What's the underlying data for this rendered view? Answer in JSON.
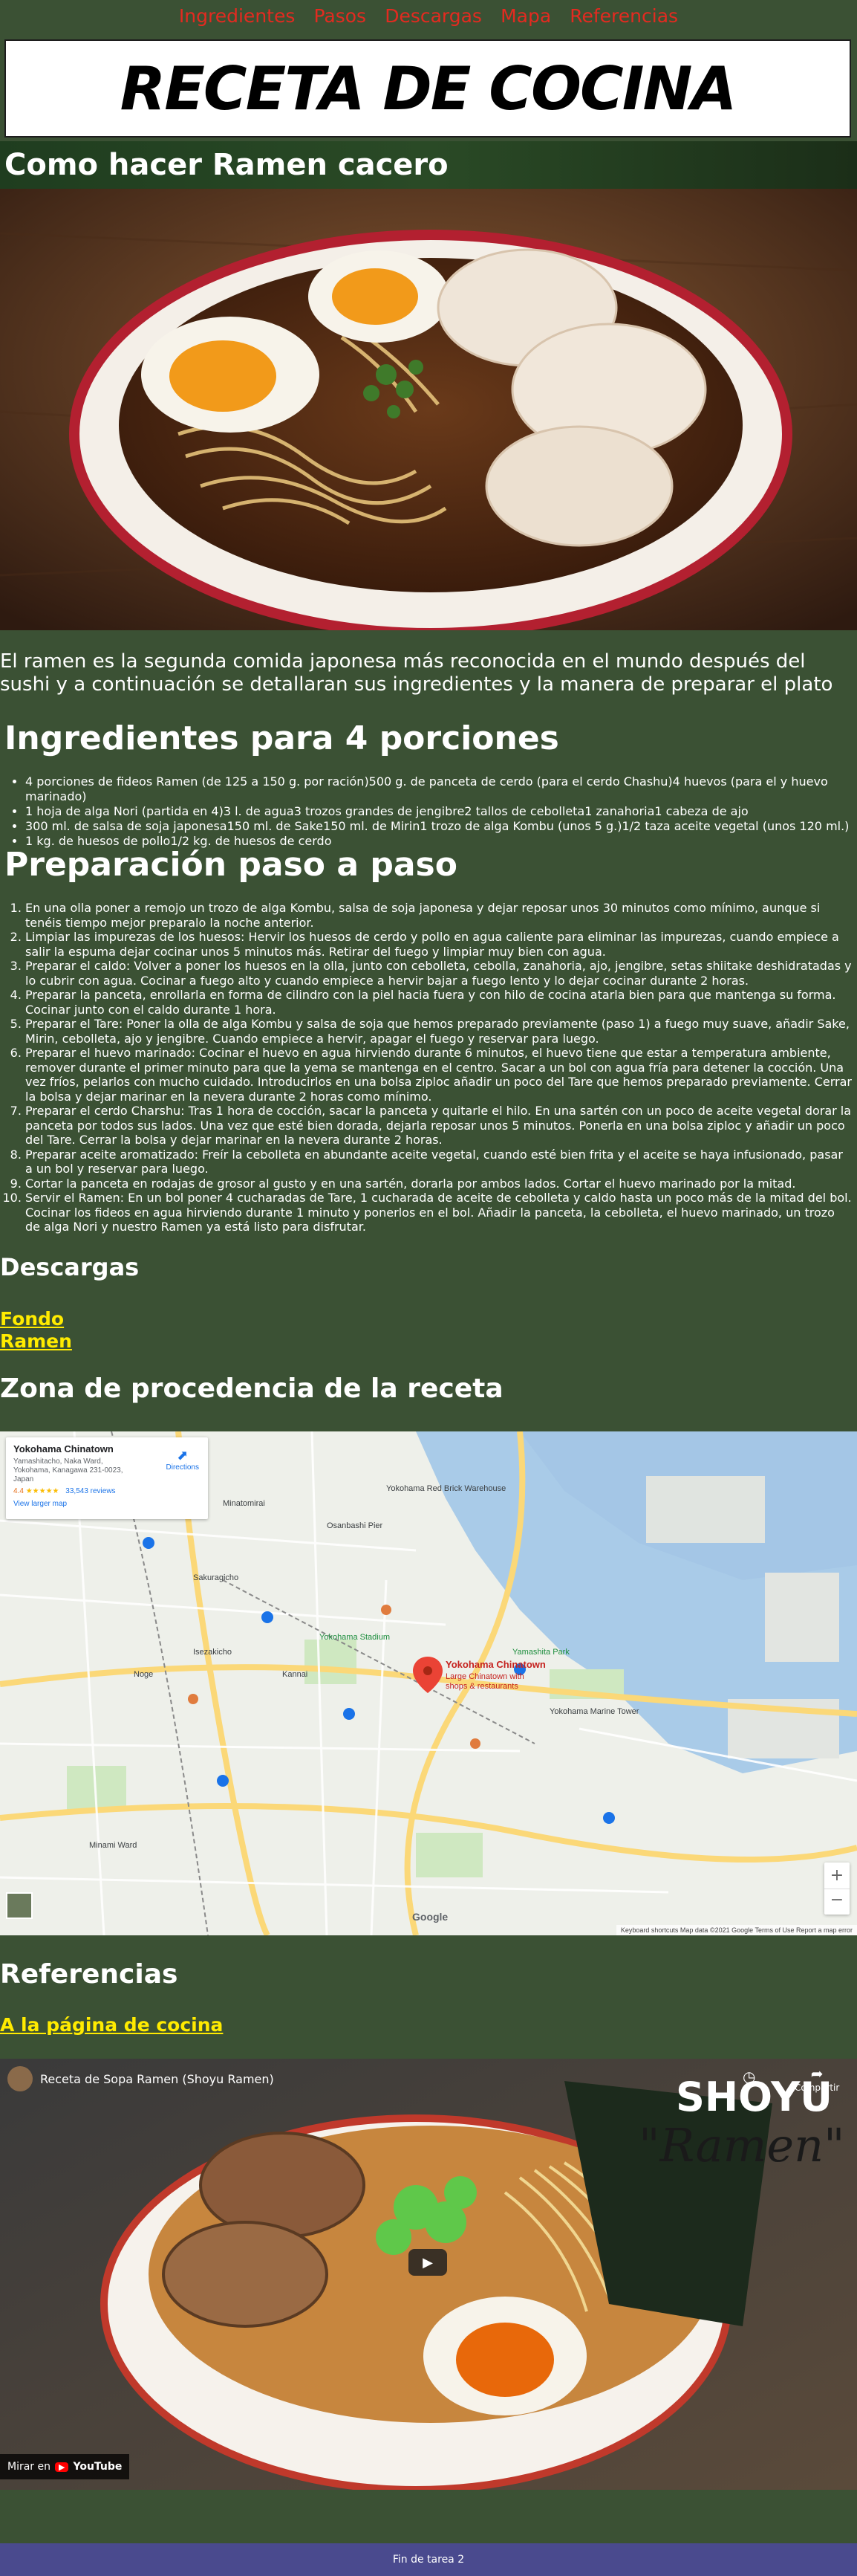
{
  "nav": {
    "items": [
      "Ingredientes",
      "Pasos",
      "Descargas",
      "Mapa",
      "Referencias"
    ]
  },
  "header": {
    "title": "RECETA DE COCINA"
  },
  "hero": {
    "subtitle": "Como hacer Ramen cacero"
  },
  "intro": {
    "text": "El ramen es la segunda comida japonesa más reconocida en el mundo después del sushi y a continuación se detallaran sus ingredientes y la manera de preparar el plato"
  },
  "ingredientes": {
    "heading": "Ingredientes para 4 porciones",
    "items": [
      "4 porciones de fideos Ramen (de 125 a 150 g. por ración)500 g. de panceta de cerdo (para el cerdo Chashu)4 huevos (para el y huevo marinado)",
      "1 hoja de alga Nori (partida en 4)3 l. de agua3 trozos grandes de jengibre2 tallos de cebolleta1 zanahoria1 cabeza de ajo",
      "300 ml. de salsa de soja japonesa150 ml. de Sake150 ml. de Mirin1 trozo de alga Kombu (unos 5 g.)1/2 taza aceite vegetal (unos 120 ml.)",
      "1 kg. de huesos de pollo1/2 kg. de huesos de cerdo"
    ]
  },
  "preparacion": {
    "heading": "Preparación paso a paso",
    "steps": [
      "En una olla poner a remojo un trozo de alga Kombu, salsa de soja japonesa y dejar reposar unos 30 minutos como mínimo, aunque si tenéis tiempo mejor preparalo la noche anterior.",
      "Limpiar las impurezas de los huesos: Hervir los huesos de cerdo y pollo en agua caliente para eliminar las impurezas, cuando empiece a salir la espuma dejar cocinar unos 5 minutos más. Retirar del fuego y limpiar muy bien con agua.",
      "Preparar el caldo: Volver a poner los huesos en la olla, junto con cebolleta, cebolla, zanahoria, ajo, jengibre, setas shiitake deshidratadas y lo cubrir con agua. Cocinar a fuego alto y cuando empiece a hervir bajar a fuego lento y lo dejar cocinar durante 2 horas.",
      "Preparar la panceta, enrollarla en forma de cilindro con la piel hacia fuera y con hilo de cocina atarla bien para que mantenga su forma. Cocinar junto con el caldo durante 1 hora.",
      "Preparar el Tare: Poner la olla de alga Kombu y salsa de soja que hemos preparado previamente (paso 1) a fuego muy suave, añadir Sake, Mirin, cebolleta, ajo y jengibre. Cuando empiece a hervir, apagar el fuego y reservar para luego.",
      "Preparar el huevo marinado: Cocinar el huevo en agua hirviendo durante 6 minutos, el huevo tiene que estar a temperatura ambiente, remover durante el primer minuto para que la yema se mantenga en el centro. Sacar a un bol con agua fría para detener la cocción. Una vez fríos, pelarlos con mucho cuidado. Introducirlos en una bolsa ziploc añadir un poco del Tare que hemos preparado previamente. Cerrar la bolsa y dejar marinar en la nevera durante 2 horas como mínimo.",
      "Preparar el cerdo Charshu: Tras 1 hora de cocción, sacar la panceta y quitarle el hilo. En una sartén con un poco de aceite vegetal dorar la panceta por todos sus lados. Una vez que esté bien dorada, dejarla reposar unos 5 minutos. Ponerla en una bolsa ziploc y añadir un poco del Tare. Cerrar la bolsa y dejar marinar en la nevera durante 2 horas.",
      "Preparar aceite aromatizado: Freír la cebolleta en abundante aceite vegetal, cuando esté bien frita y el aceite se haya infusionado, pasar a un bol y reservar para luego.",
      "Cortar la panceta en rodajas de grosor al gusto y en una sartén, dorarla por ambos lados. Cortar el huevo marinado por la mitad.",
      "Servir el Ramen: En un bol poner 4 cucharadas de Tare, 1 cucharada de aceite de cebolleta y caldo hasta un poco más de la mitad del bol. Cocinar los fideos en agua hirviendo durante 1 minuto y ponerlos en el bol. Añadir la panceta, la cebolleta, el huevo marinado, un trozo de alga Nori y nuestro Ramen ya está listo para disfrutar."
    ]
  },
  "descargas": {
    "heading": "Descargas",
    "links": [
      "Fondo",
      "Ramen"
    ]
  },
  "zona": {
    "heading": "Zona de procedencia de la receta"
  },
  "map": {
    "card_title": "Yokohama Chinatown",
    "card_address_1": "Yamashitacho, Naka Ward,",
    "card_address_2": "Yokohama, Kanagawa 231-0023,",
    "card_address_3": "Japan",
    "rating": "4.4",
    "stars": "★★★★★",
    "reviews": "33,543 reviews",
    "larger_map": "View larger map",
    "directions": "Directions",
    "pin_label": "Yokohama Chinatown",
    "pin_sub1": "Large Chinatown with",
    "pin_sub2": "shops & restaurants",
    "labels": [
      "Yokohama Red Brick Warehouse",
      "Minatomirai",
      "Yokohama Chinatown",
      "Yokohama Stadium",
      "Yamashita Park",
      "Yokohama Marine Tower",
      "Kannai",
      "Sakuragicho",
      "Noge",
      "Minami Ward",
      "Osanbashi Pier",
      "Isezakicho"
    ],
    "attrib": "Keyboard shortcuts   Map data ©2021 Google   Terms of Use   Report a map error",
    "google": "Google",
    "zoom_in": "+",
    "zoom_out": "−"
  },
  "referencias": {
    "heading": "Referencias",
    "link": "A la página de cocina"
  },
  "video": {
    "title": "Receta de Sopa Ramen (Shoyu Ramen)",
    "share": "Compartir",
    "watch_on": "Mirar en",
    "youtube": "YouTube",
    "overlay_title": "SHOYU",
    "overlay_script": "\"Ramen\""
  },
  "footer": {
    "text": "Fin de tarea 2"
  },
  "colors": {
    "bg": "#3b5134",
    "nav": "#e32a20",
    "link": "#ffeb00",
    "footer": "#4a4a8e"
  }
}
